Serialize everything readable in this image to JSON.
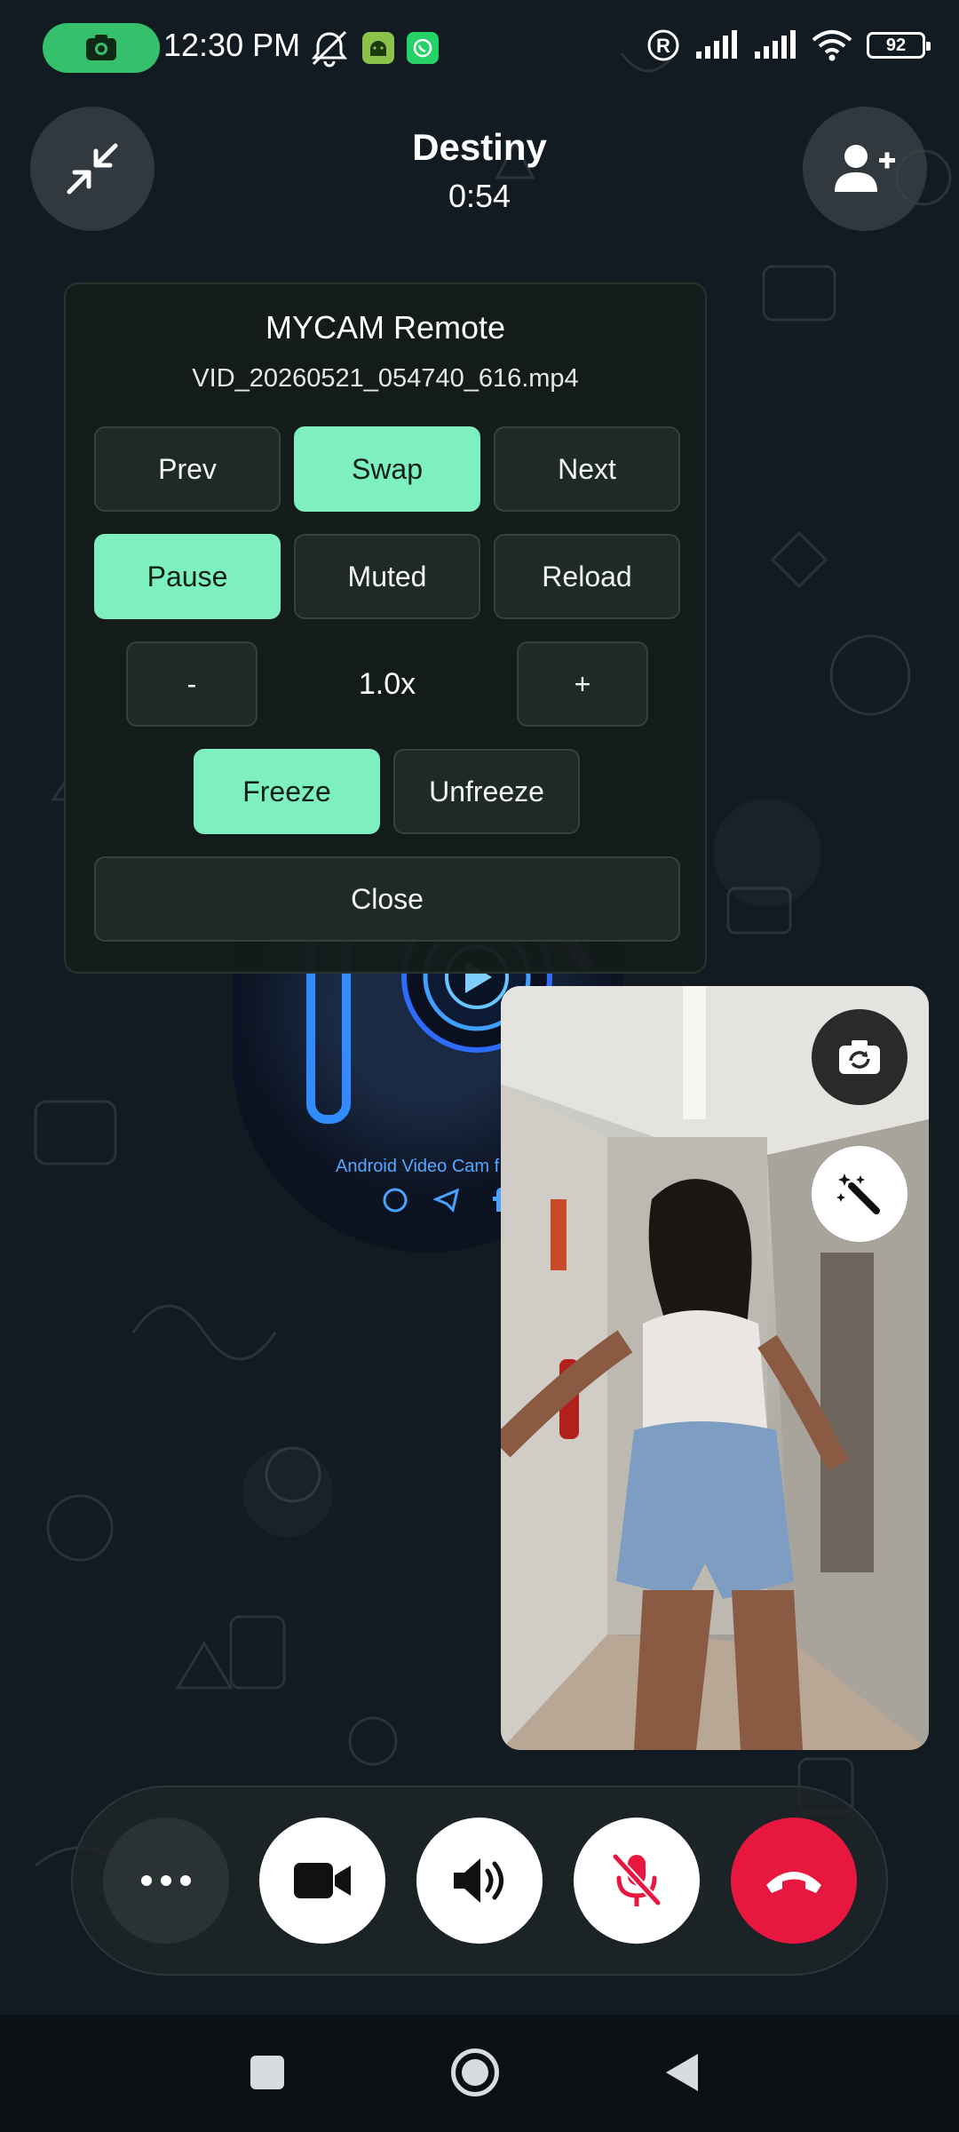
{
  "status_bar": {
    "time": "12:30 PM",
    "battery": "92",
    "icons_left": [
      "camera-recording-icon",
      "bell-off-icon",
      "android-icon",
      "whatsapp-icon"
    ],
    "icons_right": [
      "registered-icon",
      "signal-icon",
      "signal-icon",
      "wifi-icon",
      "battery-icon"
    ]
  },
  "call": {
    "caller_name": "Destiny",
    "timer": "0:54",
    "minimize_icon": "minimize-icon",
    "add_participant_icon": "add-person-icon"
  },
  "remote_panel": {
    "title": "MYCAM Remote",
    "file_name": "VID_20260521_054740_616.mp4",
    "row1": [
      {
        "label": "Prev",
        "active": false
      },
      {
        "label": "Swap",
        "active": true
      },
      {
        "label": "Next",
        "active": false
      }
    ],
    "row2": [
      {
        "label": "Pause",
        "active": true
      },
      {
        "label": "Muted",
        "active": false
      },
      {
        "label": "Reload",
        "active": false
      }
    ],
    "speed": {
      "decrease": "-",
      "value": "1.0x",
      "increase": "+"
    },
    "row4": [
      {
        "label": "Freeze",
        "active": true
      },
      {
        "label": "Unfreeze",
        "active": false
      }
    ],
    "close_label": "Close"
  },
  "background_logo": {
    "caption": "Android Video Cam f",
    "social_icons": [
      "whatsapp-icon",
      "telegram-icon",
      "facebook-icon"
    ]
  },
  "self_view": {
    "switch_camera_icon": "switch-camera-icon",
    "effects_icon": "magic-wand-icon"
  },
  "controls": [
    {
      "name": "more-options-button",
      "icon": "more-icon"
    },
    {
      "name": "video-toggle-button",
      "icon": "video-camera-icon"
    },
    {
      "name": "speaker-button",
      "icon": "speaker-icon"
    },
    {
      "name": "mute-mic-button",
      "icon": "mic-off-icon"
    },
    {
      "name": "end-call-button",
      "icon": "end-call-icon"
    }
  ],
  "colors": {
    "accent_green": "#7ef0bf",
    "end_call_red": "#e8173f",
    "mic_off_red": "#e8173f",
    "recording_pill": "#35c16b"
  },
  "nav_bar": [
    "recent-apps-icon",
    "home-icon",
    "back-icon"
  ]
}
